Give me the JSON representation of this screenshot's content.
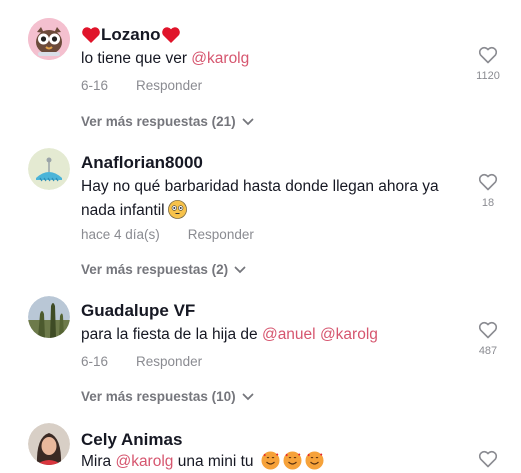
{
  "comments": [
    {
      "username": "Lozano",
      "text_plain": "lo tiene que ver ",
      "mention_1": "@karolg",
      "date": "6-16",
      "reply_label": "Responder",
      "likes": "1120",
      "more_label": "Ver más respuestas (21)"
    },
    {
      "username": "Anaflorian8000",
      "text_plain": "Hay no qué barbaridad hasta donde llegan ahora ya nada infantil",
      "date": "hace 4 día(s)",
      "reply_label": "Responder",
      "likes": "18",
      "more_label": "Ver más respuestas (2)"
    },
    {
      "username": "Guadalupe VF",
      "text_plain": "para la fiesta de la hija de ",
      "mention_1": "@anuel",
      "mention_2": "@karolg",
      "date": "6-16",
      "reply_label": "Responder",
      "likes": "487",
      "more_label": "Ver más respuestas (10)"
    },
    {
      "username": "Cely Animas",
      "text_plain": "Mira ",
      "mention_1": "@karolg",
      "text_after": " una mini tu"
    }
  ],
  "colors": {
    "mention": "#d6566f",
    "meta": "#8a8b91",
    "text": "#161823"
  }
}
